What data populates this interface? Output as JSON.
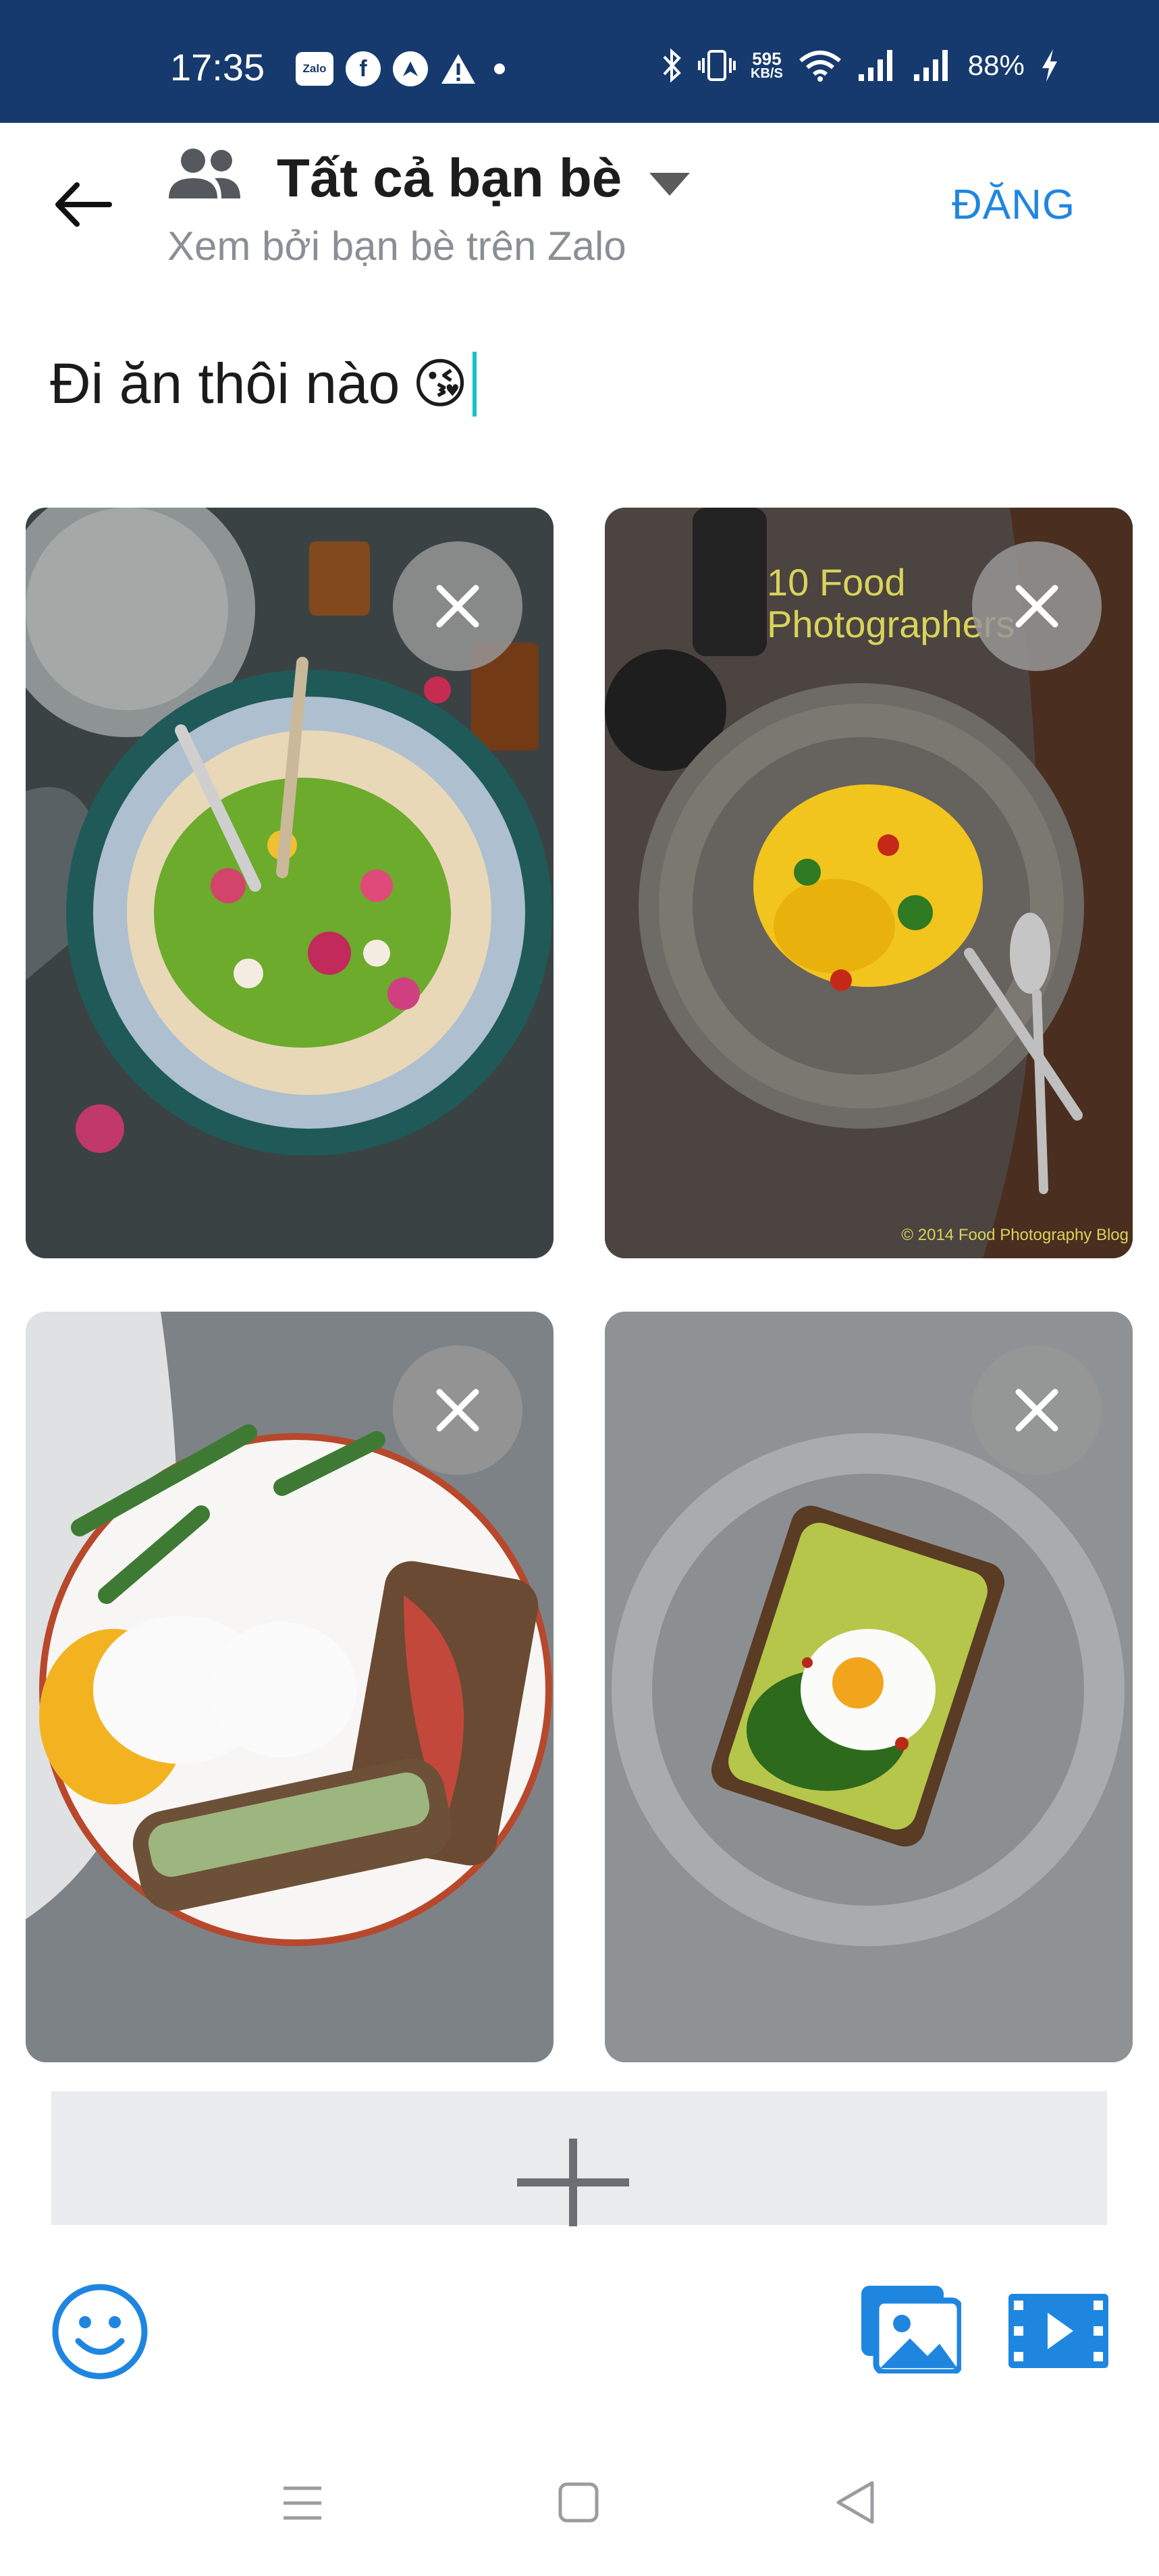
{
  "status_bar": {
    "time": "17:35",
    "app_icons": [
      "zalo-icon",
      "facebook-icon",
      "nav-arrow-icon",
      "warning-icon",
      "dot-icon"
    ],
    "zalo_label": "Zalo",
    "net_speed_value": "595",
    "net_speed_unit": "KB/S",
    "system_icons": [
      "bluetooth-icon",
      "vibrate-icon",
      "wifi-icon",
      "signal-icon",
      "signal-icon",
      "charging-icon"
    ],
    "battery": "88%"
  },
  "header": {
    "privacy_title": "Tất cả bạn bè",
    "privacy_subtitle": "Xem bởi bạn bè trên Zalo",
    "post_label": "ĐĂNG"
  },
  "composer": {
    "text": "Đi ăn thôi nào",
    "emoji": "😘"
  },
  "photos": [
    {
      "subject": "salad bowl with flowers",
      "watermark": "",
      "copyright": ""
    },
    {
      "subject": "pasta plate",
      "watermark_line1": "10 Food",
      "watermark_line2": "Photographers",
      "copyright": "© 2014 Food Photography Blog"
    },
    {
      "subject": "poached egg and prosciutto toast",
      "watermark": "",
      "copyright": ""
    },
    {
      "subject": "avocado toast with egg",
      "watermark": "",
      "copyright": ""
    }
  ],
  "colors": {
    "status_bar_bg": "#163a6e",
    "accent": "#1f86e0",
    "cursor": "#15c3c7",
    "add_more_bg": "#e9ebee"
  }
}
